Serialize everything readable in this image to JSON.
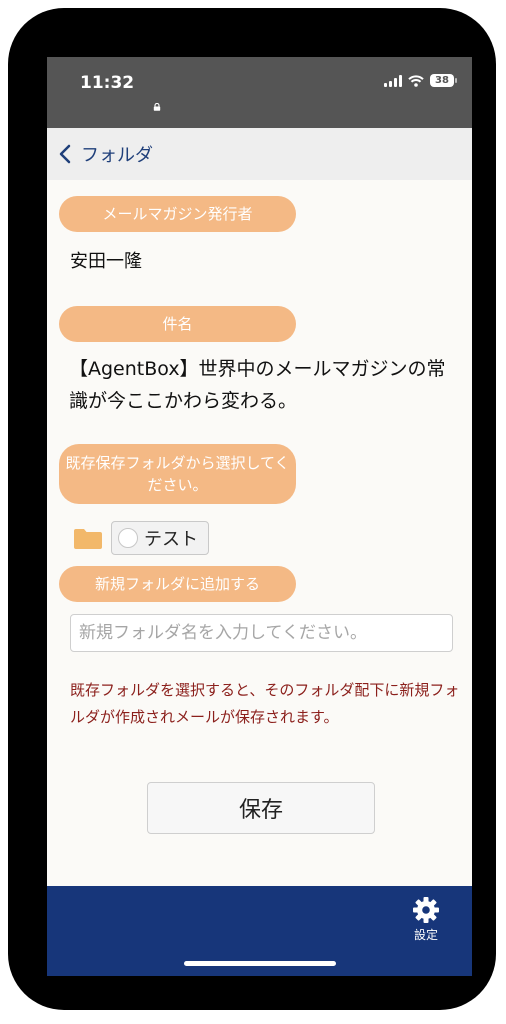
{
  "status_bar": {
    "time": "11:32",
    "battery": "38"
  },
  "navbar": {
    "back_label": "フォルダ"
  },
  "fields": {
    "publisher_label": "メールマガジン発行者",
    "publisher_value": "安田一隆",
    "subject_label": "件名",
    "subject_value": "【AgentBox】世界中のメールマガジンの常識が今ここかわら変わる。",
    "existing_folder_label": "既存保存フォルダから選択してください。",
    "folder_options": [
      {
        "name": "テスト",
        "selected": false
      }
    ],
    "new_folder_label": "新規フォルダに追加する",
    "new_folder_placeholder": "新規フォルダ名を入力してください。",
    "new_folder_value": "",
    "notice": "既存フォルダを選択すると、そのフォルダ配下に新規フォルダが作成されメールが保存されます。"
  },
  "actions": {
    "save_label": "保存"
  },
  "tab_bar": {
    "settings_label": "設定"
  },
  "colors": {
    "accent_pill": "#f4b985",
    "nav_text": "#1f3f7a",
    "tab_bar": "#17367a",
    "notice_text": "#8b1f1b",
    "status_bar": "#555555",
    "folder_icon": "#f2b86a"
  },
  "icons": {
    "back": "chevron-left-icon",
    "folder": "folder-icon",
    "settings": "gear-icon",
    "lock": "lock-icon",
    "signal": "signal-icon",
    "wifi": "wifi-icon",
    "battery": "battery-icon"
  }
}
